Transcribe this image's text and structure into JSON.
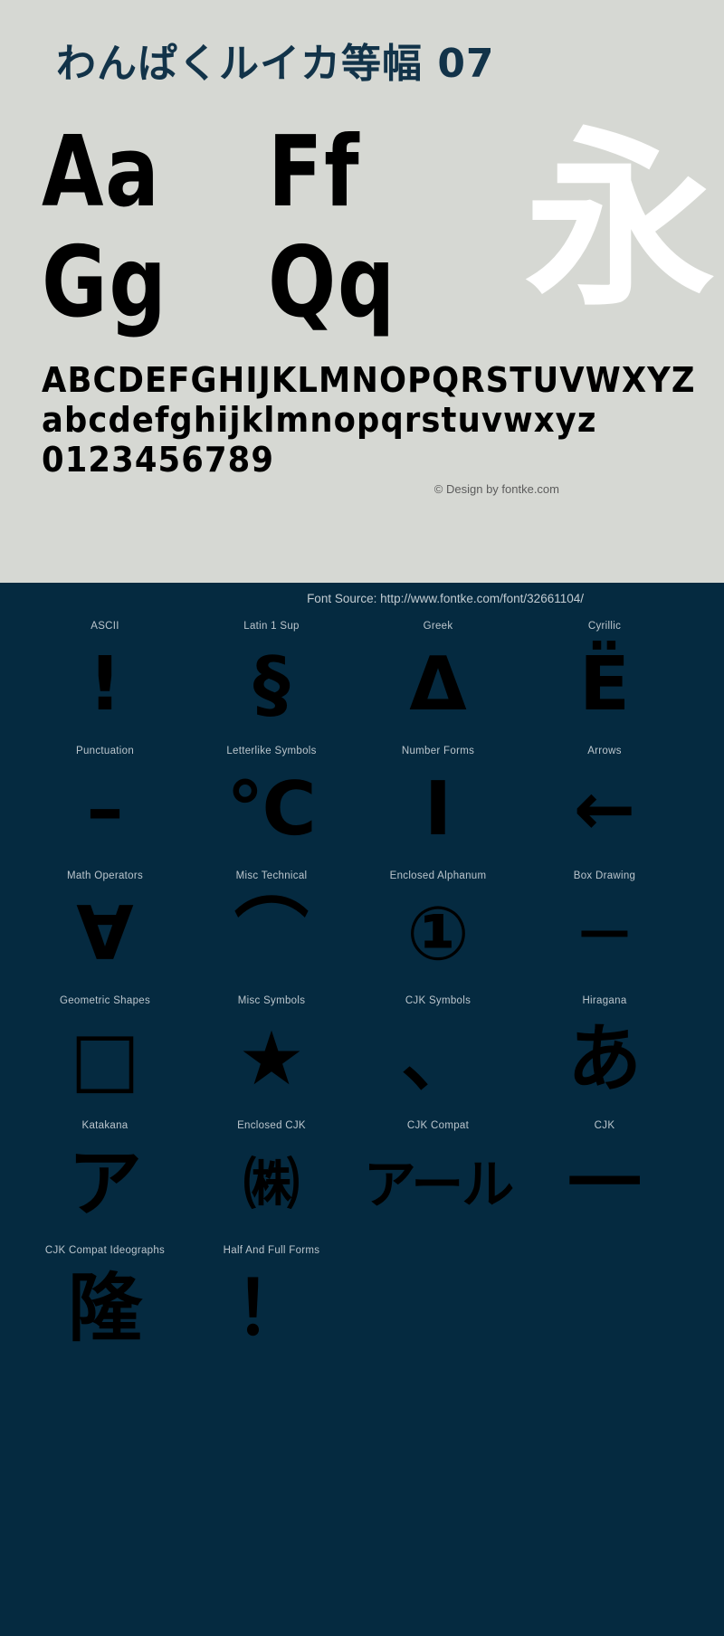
{
  "header": {
    "title": "わんぱくルイカ等幅 07"
  },
  "specimen": {
    "big_samples": [
      {
        "left": "Aa",
        "right": "Ff"
      },
      {
        "left": "Gg",
        "right": "Qq"
      }
    ],
    "cjk_sample": "永",
    "uppercase": "ABCDEFGHIJKLMNOPQRSTUVWXYZ",
    "lowercase": "abcdefghijklmnopqrstuvwxyz",
    "digits": "0123456789",
    "copyright": "© Design by fontke.com"
  },
  "footer": {
    "font_source": "Font Source: http://www.fontke.com/font/32661104/"
  },
  "glyph_grid": {
    "rows": [
      [
        {
          "label": "ASCII",
          "glyph": "!"
        },
        {
          "label": "Latin 1 Sup",
          "glyph": "§"
        },
        {
          "label": "Greek",
          "glyph": "Δ"
        },
        {
          "label": "Cyrillic",
          "glyph": "Ё"
        }
      ],
      [
        {
          "label": "Punctuation",
          "glyph": "–"
        },
        {
          "label": "Letterlike Symbols",
          "glyph": "℃"
        },
        {
          "label": "Number Forms",
          "glyph": "Ⅰ"
        },
        {
          "label": "Arrows",
          "glyph": "←"
        }
      ],
      [
        {
          "label": "Math Operators",
          "glyph": "∀"
        },
        {
          "label": "Misc Technical",
          "glyph": "⌒"
        },
        {
          "label": "Enclosed Alphanum",
          "glyph": "①"
        },
        {
          "label": "Box Drawing",
          "glyph": "─"
        }
      ],
      [
        {
          "label": "Geometric Shapes",
          "glyph": "□"
        },
        {
          "label": "Misc Symbols",
          "glyph": "★"
        },
        {
          "label": "CJK Symbols",
          "glyph": "、"
        },
        {
          "label": "Hiragana",
          "glyph": "あ"
        }
      ],
      [
        {
          "label": "Katakana",
          "glyph": "ア"
        },
        {
          "label": "Enclosed CJK",
          "glyph": "㈱"
        },
        {
          "label": "CJK Compat",
          "glyph": "アール"
        },
        {
          "label": "CJK",
          "glyph": "一"
        }
      ],
      [
        {
          "label": "CJK Compat Ideographs",
          "glyph": "隆"
        },
        {
          "label": "Half And Full Forms",
          "glyph": "！"
        },
        {
          "label": "",
          "glyph": ""
        },
        {
          "label": "",
          "glyph": ""
        }
      ]
    ]
  },
  "colors": {
    "light_background": "#d6d8d3",
    "dark_background": "#052a40",
    "title_color": "#123349",
    "glyph_color": "#000000",
    "label_color": "#bcc6cd"
  }
}
